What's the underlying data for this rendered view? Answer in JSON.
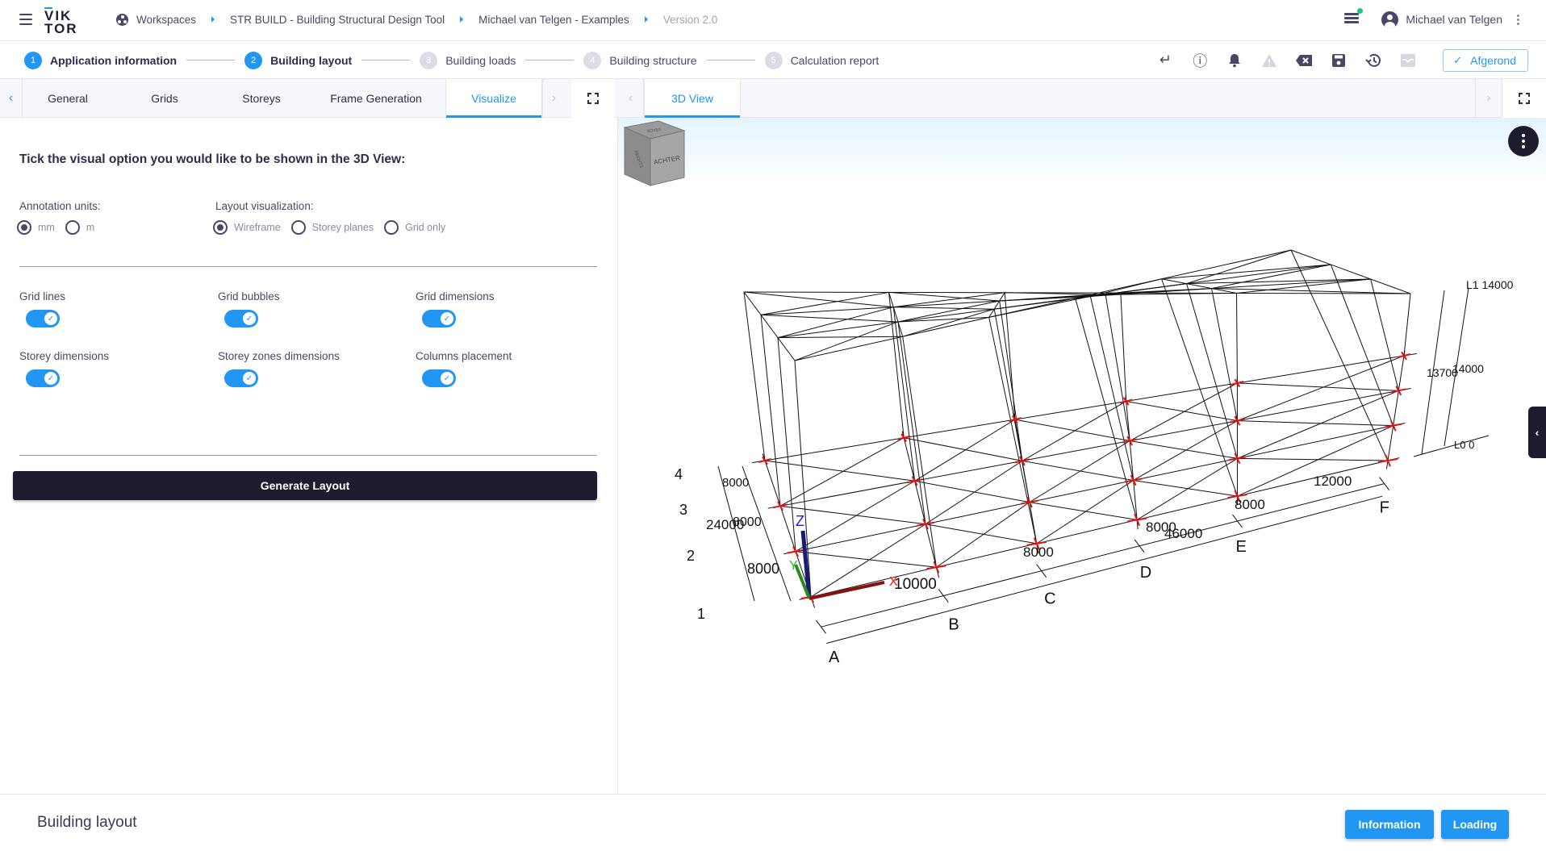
{
  "header": {
    "logo_top": "VIK",
    "logo_bottom": "TOR",
    "breadcrumbs": [
      {
        "label": "Workspaces",
        "icon": "workspaces-icon"
      },
      {
        "label": "STR BUILD - Building Structural Design Tool"
      },
      {
        "label": "Michael van Telgen - Examples"
      },
      {
        "label": "Version 2.0",
        "muted": true
      }
    ],
    "username": "Michael van Telgen",
    "job_indicator_color": "#1ec28b"
  },
  "stepper": {
    "steps": [
      {
        "num": "1",
        "label": "Application information",
        "state": "done"
      },
      {
        "num": "2",
        "label": "Building layout",
        "state": "active"
      },
      {
        "num": "3",
        "label": "Building loads",
        "state": "inactive"
      },
      {
        "num": "4",
        "label": "Building structure",
        "state": "inactive"
      },
      {
        "num": "5",
        "label": "Calculation report",
        "state": "inactive"
      }
    ]
  },
  "toolbar": {
    "icons": [
      {
        "name": "return-icon",
        "glyph": "↵",
        "disabled": false
      },
      {
        "name": "info-icon",
        "glyph": "ⓘ",
        "disabled": false
      },
      {
        "name": "bell-icon",
        "glyph": "🔔",
        "disabled": false
      },
      {
        "name": "warning-icon",
        "glyph": "▲",
        "disabled": true
      },
      {
        "name": "clear-icon",
        "glyph": "⌫",
        "disabled": false
      },
      {
        "name": "save-icon",
        "glyph": "💾",
        "disabled": false
      },
      {
        "name": "history-icon",
        "glyph": "↺",
        "disabled": false
      },
      {
        "name": "inbox-icon",
        "glyph": "▤",
        "disabled": true
      }
    ],
    "status_check": "✓",
    "status_label": "Afgerond"
  },
  "left_tabs": {
    "items": [
      "General",
      "Grids",
      "Storeys",
      "Frame Generation",
      "Visualize"
    ],
    "active": "Visualize",
    "prev_arrow": "‹",
    "next_arrow": "›"
  },
  "form": {
    "intro": "Tick the visual option you would like to be shown in the 3D View:",
    "annotation_units": {
      "label": "Annotation units:",
      "options": [
        "mm",
        "m"
      ],
      "selected": "mm"
    },
    "layout_visualization": {
      "label": "Layout visualization:",
      "options": [
        "Wireframe",
        "Storey planes",
        "Grid only"
      ],
      "selected": "Wireframe"
    },
    "toggles": [
      {
        "label": "Grid lines",
        "on": true
      },
      {
        "label": "Grid bubbles",
        "on": true
      },
      {
        "label": "Grid dimensions",
        "on": true
      },
      {
        "label": "Storey dimensions",
        "on": true
      },
      {
        "label": "Storey zones dimensions",
        "on": true
      },
      {
        "label": "Columns placement",
        "on": true
      }
    ],
    "toggle_check": "✓",
    "generate_label": "Generate Layout"
  },
  "right_tabs": {
    "items": [
      "3D View"
    ],
    "active": "3D View",
    "prev_arrow": "‹",
    "next_arrow": "›"
  },
  "viewer": {
    "grid_x_labels": [
      "A",
      "B",
      "C",
      "D",
      "E",
      "F"
    ],
    "grid_y_labels": [
      "1",
      "2",
      "3",
      "4"
    ],
    "x_dimensions": [
      "10000",
      "8000",
      "8000",
      "8000",
      "12000"
    ],
    "x_total": "46000",
    "y_dimensions": [
      "8000",
      "8000",
      "8000"
    ],
    "y_total": "24000",
    "levels": [
      {
        "label": "L0 0"
      },
      {
        "label": "L1 14000"
      }
    ],
    "storey_dimension": "14000",
    "zone_dimension": "13700",
    "axes": {
      "x": "X",
      "y": "Y",
      "z": "Z"
    },
    "viewcube": {
      "top": "BOVEN",
      "left": "RECHTS",
      "front": "ACHTER"
    },
    "side_tab_glyph": "‹"
  },
  "footer": {
    "title": "Building layout",
    "buttons": [
      "Information",
      "Loading"
    ]
  }
}
